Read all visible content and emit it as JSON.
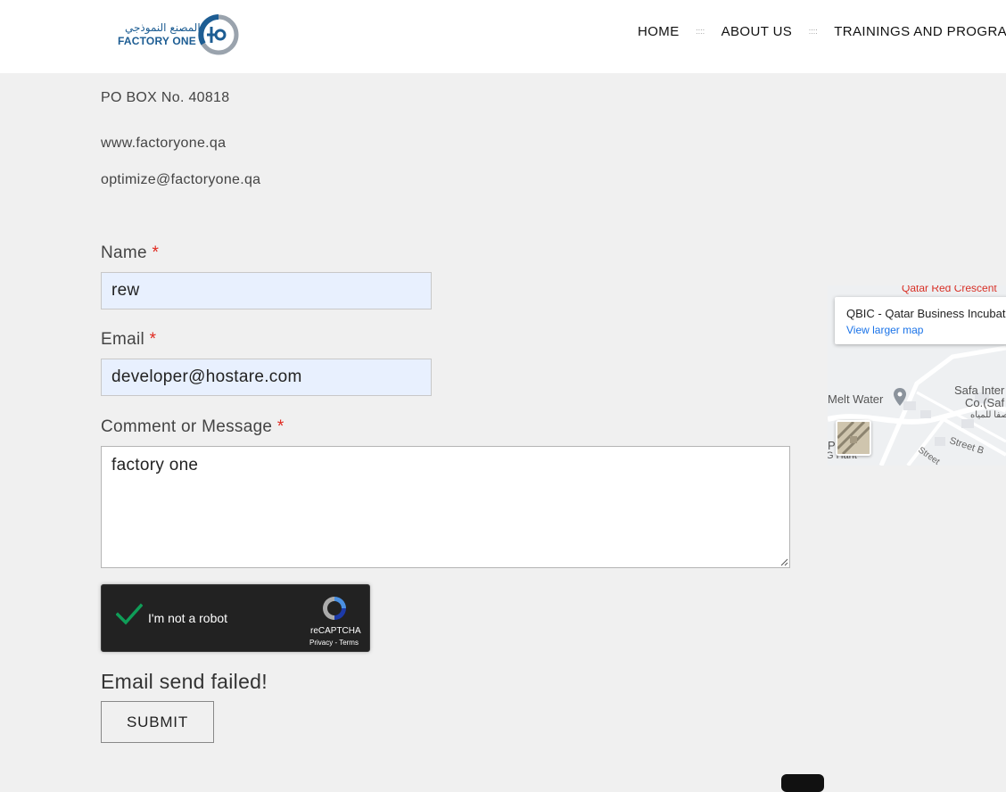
{
  "header": {
    "logo": {
      "text_ar": "المصنع النموذجي",
      "text_en": "FACTORY ONE"
    },
    "nav": [
      {
        "label": "HOME"
      },
      {
        "label": "ABOUT US"
      },
      {
        "label": "TRAININGS AND PROGRAM"
      }
    ],
    "nav_separator": "::::"
  },
  "contact": {
    "po_box": "PO BOX No. 40818",
    "website": "www.factoryone.qa",
    "email": "optimize@factoryone.qa"
  },
  "form": {
    "required_mark": "*",
    "name_label": "Name",
    "name_value": "rew",
    "email_label": "Email",
    "email_value": "developer@hostare.com",
    "message_label": "Comment or Message",
    "message_value": "factory one",
    "status": "Email send failed!",
    "submit_label": "SUBMIT"
  },
  "recaptcha": {
    "label": "I'm not a robot",
    "brand": "reCAPTCHA",
    "links": "Privacy - Terms",
    "checked": true,
    "check_color": "#0f9d58"
  },
  "map": {
    "place_title": "QBIC - Qatar Business Incubat",
    "view_larger": "View larger map",
    "top_label": "Qatar Red Crescent",
    "melt_water": "Melt Water",
    "safa_line1": "Safa Inter",
    "safa_line2": "Co.(Saf",
    "safa_ar": "صفا للمياه",
    "street_b": "Street B",
    "street": "Street",
    "hant": "G Hant",
    "p": "P"
  },
  "colors": {
    "page_bg": "#f0f0f0",
    "autofill_bg": "#e8f0fe",
    "required": "#e0281e",
    "link": "#1a73e8",
    "brand_blue": "#1d5d93"
  }
}
